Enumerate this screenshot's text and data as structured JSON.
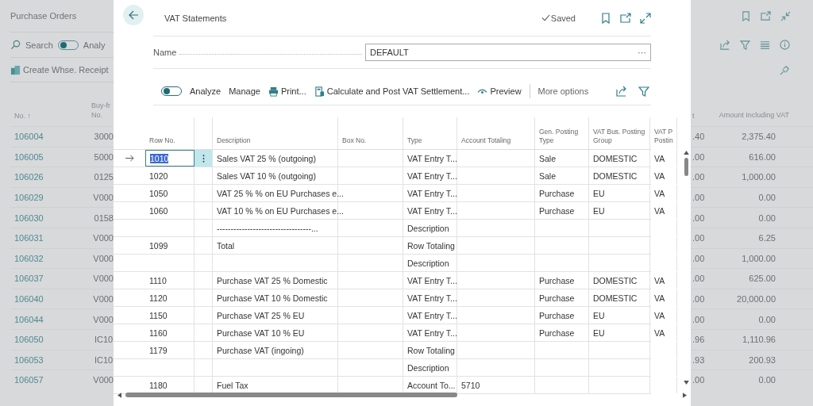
{
  "background_page": {
    "title": "Purchase Orders",
    "search_label": "Search",
    "analyze_toggle": {
      "on": false
    },
    "analyze_label": "Analy",
    "action_label": "Create Whse. Receipt",
    "columns": [
      "No. ↑",
      "Buy-fr No.",
      "t",
      "Amount Including VAT"
    ],
    "rows": [
      {
        "no": "106004",
        "vendor": "3000",
        "amount": ".40",
        "amount_incl": "2,375.40"
      },
      {
        "no": "106005",
        "vendor": "5000",
        "amount": ".00",
        "amount_incl": "616.00"
      },
      {
        "no": "106026",
        "vendor": "0125",
        "amount": ".00",
        "amount_incl": "1,000.00"
      },
      {
        "no": "106029",
        "vendor": "V000",
        "amount": ".00",
        "amount_incl": "0.00"
      },
      {
        "no": "106030",
        "vendor": "0158",
        "amount": ".00",
        "amount_incl": "0.00"
      },
      {
        "no": "106031",
        "vendor": "V000",
        "amount": ".00",
        "amount_incl": "6.25"
      },
      {
        "no": "106032",
        "vendor": "V000",
        "amount": ".00",
        "amount_incl": "1,000.00"
      },
      {
        "no": "106037",
        "vendor": "V000",
        "amount": ".00",
        "amount_incl": "625.00"
      },
      {
        "no": "106040",
        "vendor": "V000",
        "amount": ".00",
        "amount_incl": "20,000.00"
      },
      {
        "no": "106044",
        "vendor": "V000",
        "amount": ".00",
        "amount_incl": "0.00"
      },
      {
        "no": "106050",
        "vendor": "IC10",
        "amount": ".96",
        "amount_incl": "1,110.96"
      },
      {
        "no": "106053",
        "vendor": "IC10",
        "amount": ".93",
        "amount_incl": "200.93"
      },
      {
        "no": "106057",
        "vendor": "V000",
        "amount": ".00",
        "amount_incl": "0.00"
      }
    ]
  },
  "dialog": {
    "title": "VAT Statements",
    "status": "Saved",
    "name_label": "Name",
    "name_value": "DEFAULT",
    "name_button": "···",
    "analyze_toggle": {
      "on": false
    },
    "actions": [
      {
        "kind": "toggle",
        "label": "Analyze"
      },
      {
        "kind": "plain",
        "label": "Manage"
      },
      {
        "kind": "print",
        "label": "Print..."
      },
      {
        "kind": "calc",
        "label": "Calculate and Post VAT Settlement..."
      },
      {
        "kind": "preview",
        "label": "Preview"
      },
      {
        "kind": "more",
        "label": "More options"
      }
    ],
    "columns": [
      "Row No.",
      "Description",
      "Box No.",
      "Type",
      "Account Totaling",
      "Gen. Posting Type",
      "VAT Bus. Posting Group",
      "VAT P Postin"
    ],
    "rows": [
      {
        "selected": true,
        "row_no": "1010",
        "description": "Sales VAT 25 % (outgoing)",
        "type": "VAT Entry T...",
        "gen_posting_type": "Sale",
        "vat_bus_posting_group": "DOMESTIC",
        "column_8": "VA"
      },
      {
        "selected": false,
        "row_no": "1020",
        "description": "Sales VAT 10 % (outgoing)",
        "type": "VAT Entry T...",
        "gen_posting_type": "Sale",
        "vat_bus_posting_group": "DOMESTIC",
        "column_8": "VA"
      },
      {
        "selected": false,
        "row_no": "1050",
        "description": "VAT 25 % % on EU Purchases e...",
        "type": "VAT Entry T...",
        "gen_posting_type": "Purchase",
        "vat_bus_posting_group": "EU",
        "column_8": "VA"
      },
      {
        "selected": false,
        "row_no": "1060",
        "description": "VAT 10 % % on EU Purchases e...",
        "type": "VAT Entry T...",
        "gen_posting_type": "Purchase",
        "vat_bus_posting_group": "EU",
        "column_8": "VA"
      },
      {
        "selected": false,
        "description": "----------------------------------...",
        "type": "Description"
      },
      {
        "selected": false,
        "row_no": "1099",
        "description": "Total",
        "type": "Row Totaling"
      },
      {
        "selected": false,
        "type": "Description"
      },
      {
        "selected": false,
        "row_no": "1110",
        "description": "Purchase VAT 25 % Domestic",
        "type": "VAT Entry T...",
        "gen_posting_type": "Purchase",
        "vat_bus_posting_group": "DOMESTIC",
        "column_8": "VA"
      },
      {
        "selected": false,
        "row_no": "1120",
        "description": "Purchase VAT 10 % Domestic",
        "type": "VAT Entry T...",
        "gen_posting_type": "Purchase",
        "vat_bus_posting_group": "DOMESTIC",
        "column_8": "VA"
      },
      {
        "selected": false,
        "row_no": "1150",
        "description": "Purchase VAT 25 % EU",
        "type": "VAT Entry T...",
        "gen_posting_type": "Purchase",
        "vat_bus_posting_group": "EU",
        "column_8": "VA"
      },
      {
        "selected": false,
        "row_no": "1160",
        "description": "Purchase VAT 10 % EU",
        "type": "VAT Entry T...",
        "gen_posting_type": "Purchase",
        "vat_bus_posting_group": "EU",
        "column_8": "VA"
      },
      {
        "selected": false,
        "row_no": "1179",
        "description": "Purchase VAT (ingoing)",
        "type": "Row Totaling"
      },
      {
        "selected": false,
        "type": "Description"
      },
      {
        "selected": false,
        "row_no": "1180",
        "description": "Fuel Tax",
        "type": "Account To...",
        "account_totaling": "5710"
      }
    ]
  }
}
